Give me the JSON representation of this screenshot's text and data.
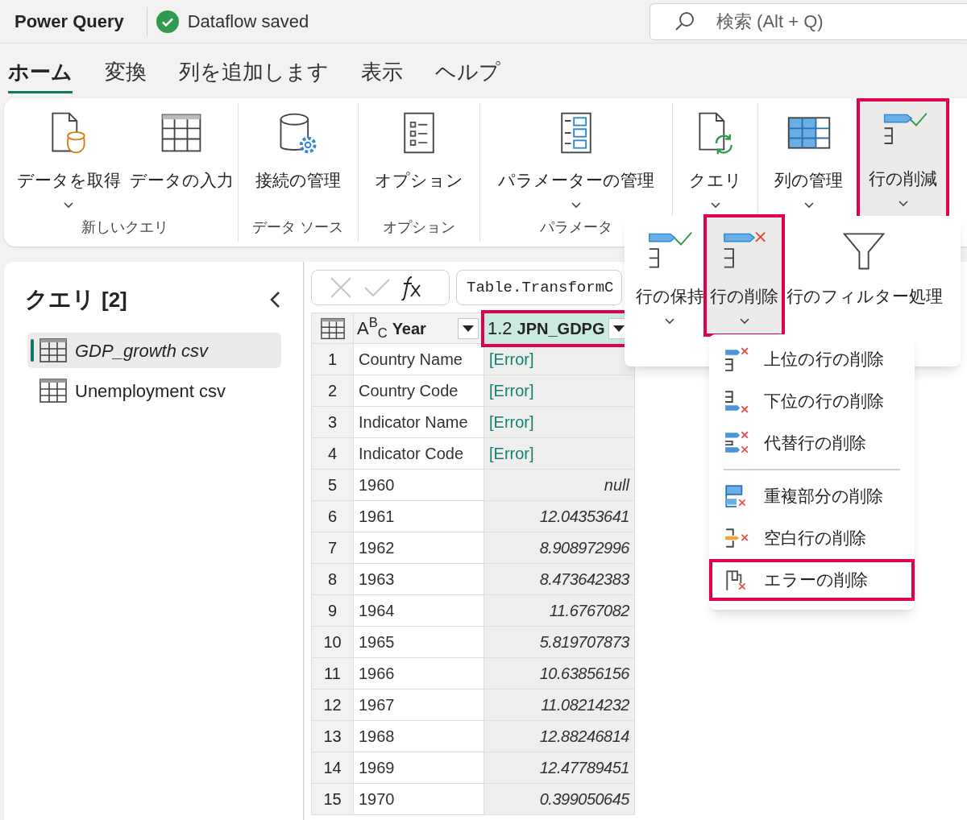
{
  "app": {
    "title": "Power Query",
    "save_status": "Dataflow saved",
    "search": {
      "placeholder": "検索 (Alt + Q)"
    }
  },
  "tabs": [
    {
      "label": "ホーム",
      "selected": true
    },
    {
      "label": "変換",
      "selected": false
    },
    {
      "label": "列を追加します",
      "selected": false
    },
    {
      "label": "表示",
      "selected": false
    },
    {
      "label": "ヘルプ",
      "selected": false
    }
  ],
  "ribbon": {
    "groups": [
      {
        "label": "新しいクエリ",
        "buttons": [
          {
            "label": "データを取得",
            "dropdown": true,
            "selected": false,
            "highlighted": false
          },
          {
            "label": "データの入力",
            "dropdown": false,
            "selected": false,
            "highlighted": false
          }
        ]
      },
      {
        "label": "データ ソース",
        "buttons": [
          {
            "label": "接続の管理",
            "dropdown": false,
            "selected": false,
            "highlighted": false
          }
        ]
      },
      {
        "label": "オプション",
        "buttons": [
          {
            "label": "オプション",
            "dropdown": false,
            "selected": false,
            "highlighted": false
          }
        ]
      },
      {
        "label": "パラメータ",
        "buttons": [
          {
            "label": "パラメーターの管理",
            "dropdown": true,
            "selected": false,
            "highlighted": false
          }
        ]
      },
      {
        "buttons": [
          {
            "label": "クエリ",
            "dropdown": true,
            "selected": false,
            "highlighted": false
          }
        ]
      },
      {
        "buttons": [
          {
            "label": "列の管理",
            "dropdown": true,
            "selected": false,
            "highlighted": false
          }
        ]
      },
      {
        "buttons": [
          {
            "label": "行の削減",
            "dropdown": true,
            "selected": true,
            "highlighted": true
          }
        ]
      }
    ]
  },
  "row_reduction_menu": {
    "buttons": [
      {
        "label": "行の保持",
        "dropdown": true,
        "selected": false,
        "highlighted": false
      },
      {
        "label": "行の削除",
        "dropdown": true,
        "selected": true,
        "highlighted": true
      },
      {
        "label": "行のフィルター処理",
        "dropdown": false,
        "selected": false,
        "highlighted": false
      }
    ]
  },
  "remove_rows_menu": {
    "sections": [
      [
        {
          "label": "上位の行の削除",
          "highlighted": false
        },
        {
          "label": "下位の行の削除",
          "highlighted": false
        },
        {
          "label": "代替行の削除",
          "highlighted": false
        }
      ],
      [
        {
          "label": "重複部分の削除",
          "highlighted": false
        },
        {
          "label": "空白行の削除",
          "highlighted": false
        },
        {
          "label": "エラーの削除",
          "highlighted": true
        }
      ]
    ]
  },
  "queries_pane": {
    "title": "クエリ",
    "count": "[2]",
    "items": [
      {
        "name": "GDP_growth csv",
        "selected": true
      },
      {
        "name": "Unemployment csv",
        "selected": false
      }
    ]
  },
  "formula_bar": {
    "formula": "Table.TransformC"
  },
  "table": {
    "columns": [
      {
        "type_label": "A$^{B}$$_{C}$",
        "name": "Year",
        "highlighted": false
      },
      {
        "type_label": "1.2",
        "name": "JPN_GDPG",
        "highlighted": true
      }
    ],
    "rows": [
      {
        "number": "1",
        "year": "Country Name",
        "value": "[Error]",
        "kind": "error"
      },
      {
        "number": "2",
        "year": "Country Code",
        "value": "[Error]",
        "kind": "error"
      },
      {
        "number": "3",
        "year": "Indicator Name",
        "value": "[Error]",
        "kind": "error"
      },
      {
        "number": "4",
        "year": "Indicator Code",
        "value": "[Error]",
        "kind": "error"
      },
      {
        "number": "5",
        "year": "1960",
        "value": "null",
        "kind": "null"
      },
      {
        "number": "6",
        "year": "1961",
        "value": "12.04353641",
        "kind": "number"
      },
      {
        "number": "7",
        "year": "1962",
        "value": "8.908972996",
        "kind": "number"
      },
      {
        "number": "8",
        "year": "1963",
        "value": "8.473642383",
        "kind": "number"
      },
      {
        "number": "9",
        "year": "1964",
        "value": "11.6767082",
        "kind": "number"
      },
      {
        "number": "10",
        "year": "1965",
        "value": "5.819707873",
        "kind": "number"
      },
      {
        "number": "11",
        "year": "1966",
        "value": "10.63856156",
        "kind": "number"
      },
      {
        "number": "12",
        "year": "1967",
        "value": "11.08214232",
        "kind": "number"
      },
      {
        "number": "13",
        "year": "1968",
        "value": "12.88246814",
        "kind": "number"
      },
      {
        "number": "14",
        "year": "1969",
        "value": "12.47789451",
        "kind": "number"
      },
      {
        "number": "15",
        "year": "1970",
        "value": "0.399050645",
        "kind": "number"
      }
    ]
  }
}
